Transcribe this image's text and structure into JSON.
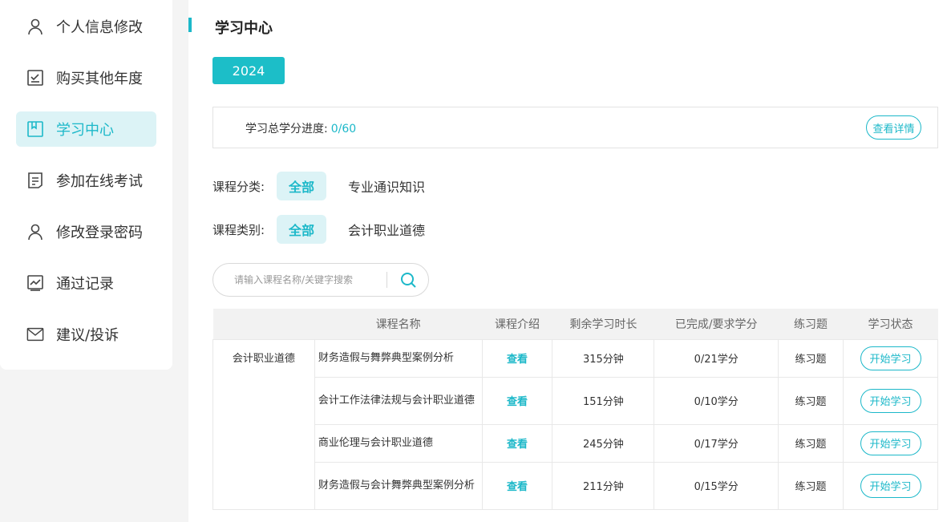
{
  "sidebar": {
    "items": [
      {
        "label": "个人信息修改",
        "icon": "user-icon"
      },
      {
        "label": "购买其他年度",
        "icon": "checklist-icon"
      },
      {
        "label": "学习中心",
        "icon": "bookmark-icon",
        "active": true
      },
      {
        "label": "参加在线考试",
        "icon": "document-icon"
      },
      {
        "label": "修改登录密码",
        "icon": "user-icon"
      },
      {
        "label": "通过记录",
        "icon": "chart-icon"
      },
      {
        "label": "建议/投诉",
        "icon": "mail-icon"
      }
    ]
  },
  "main": {
    "title": "学习中心",
    "year": "2024",
    "progress": {
      "label": "学习总学分进度:",
      "value": "0/60",
      "detail_button": "查看详情"
    },
    "filters": {
      "category": {
        "label": "课程分类:",
        "active": "全部",
        "option": "专业通识知识"
      },
      "type": {
        "label": "课程类别:",
        "active": "全部",
        "option": "会计职业道德"
      }
    },
    "search": {
      "placeholder": "请输入课程名称/关键字搜索"
    },
    "table": {
      "headers": [
        "",
        "课程名称",
        "课程介绍",
        "剩余学习时长",
        "已完成/要求学分",
        "练习题",
        "学习状态"
      ],
      "category": "会计职业道德",
      "rows": [
        {
          "name": "财务造假与舞弊典型案例分析",
          "intro": "查看",
          "duration": "315分钟",
          "credit": "0/21学分",
          "exercise": "练习题",
          "status": "开始学习"
        },
        {
          "name": "会计工作法律法规与会计职业道德",
          "intro": "查看",
          "duration": "151分钟",
          "credit": "0/10学分",
          "exercise": "练习题",
          "status": "开始学习"
        },
        {
          "name": "商业伦理与会计职业道德",
          "intro": "查看",
          "duration": "245分钟",
          "credit": "0/17学分",
          "exercise": "练习题",
          "status": "开始学习"
        },
        {
          "name": "财务造假与会计舞弊典型案例分析",
          "intro": "查看",
          "duration": "211分钟",
          "credit": "0/15学分",
          "exercise": "练习题",
          "status": "开始学习"
        }
      ]
    }
  },
  "colors": {
    "accent": "#1cb8c9",
    "active_bg": "#dcf3f6"
  }
}
